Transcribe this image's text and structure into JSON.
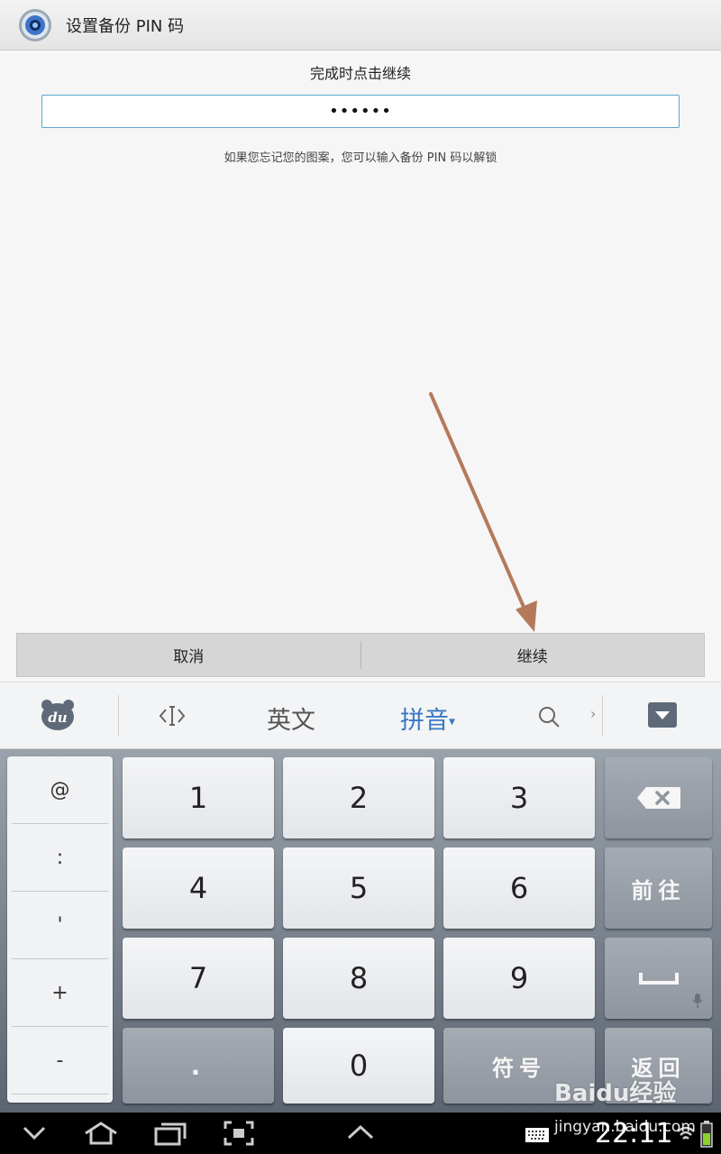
{
  "titlebar": {
    "title": "设置备份 PIN 码",
    "icon": "settings-gear-icon"
  },
  "content": {
    "prompt": "完成时点击继续",
    "pin_value": "••••••",
    "hint": "如果您忘记您的图案，您可以输入备份 PIN 码以解锁"
  },
  "buttons": {
    "cancel": "取消",
    "continue": "继续"
  },
  "ime": {
    "logo": "du",
    "english": "英文",
    "pinyin": "拼音",
    "more": "›",
    "icons": [
      "cursor-icon",
      "search-icon",
      "hide-keyboard-icon"
    ]
  },
  "keyboard": {
    "symbols": [
      "@",
      ":",
      "'",
      "+",
      "-"
    ],
    "digits": [
      "1",
      "2",
      "3",
      "4",
      "5",
      "6",
      "7",
      "8",
      "9",
      "0"
    ],
    "dot": ".",
    "symbols_key": "符号",
    "go_key": "前往",
    "back_key": "返回"
  },
  "statusbar": {
    "clock": "22:11"
  },
  "watermark": {
    "brand": "Baidu经验",
    "url": "jingyan.baidu.com"
  },
  "colors": {
    "accent": "#3a78c2",
    "field_border": "#5aa7c9",
    "arrow": "#b5795a"
  }
}
